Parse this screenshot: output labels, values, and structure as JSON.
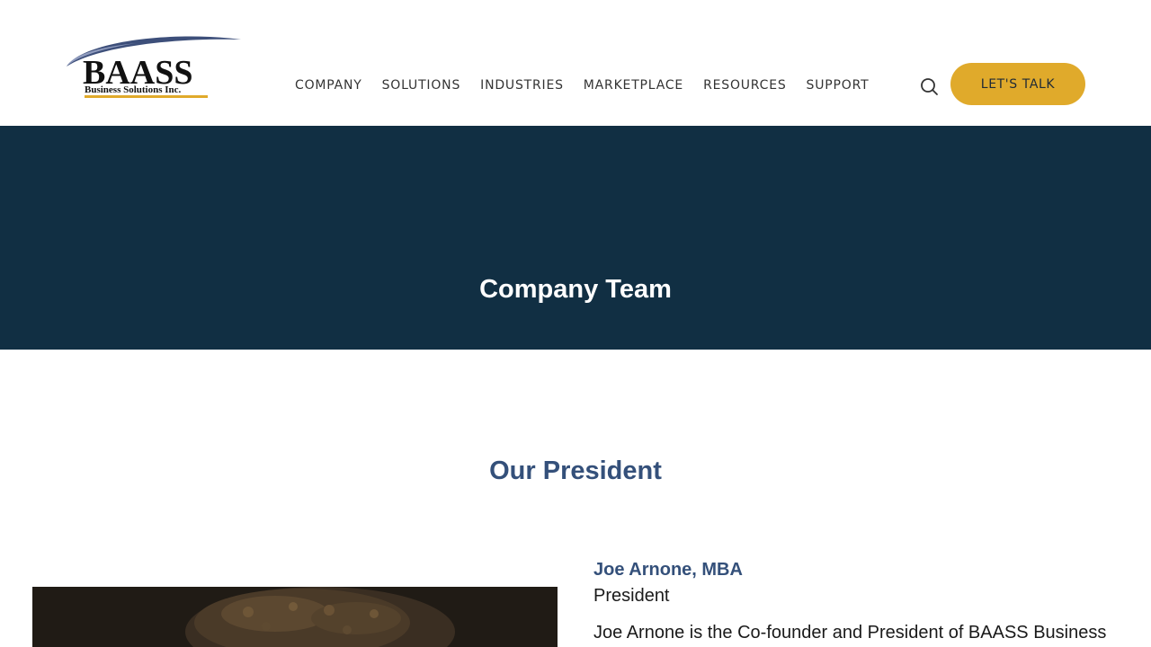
{
  "header": {
    "logo": {
      "name": "BAASS",
      "tagline": "Business Solutions Inc."
    },
    "nav": [
      {
        "label": "COMPANY"
      },
      {
        "label": "SOLUTIONS"
      },
      {
        "label": "INDUSTRIES"
      },
      {
        "label": "MARKETPLACE"
      },
      {
        "label": "RESOURCES"
      },
      {
        "label": "SUPPORT"
      }
    ],
    "search_icon": "search-icon",
    "cta_label": "LET'S TALK"
  },
  "hero": {
    "title": "Company Team"
  },
  "section": {
    "title": "Our President"
  },
  "president": {
    "name": "Joe Arnone, MBA",
    "role": "President",
    "bio_start": "Joe Arnone is the Co-founder and President of BAASS Business"
  },
  "colors": {
    "hero_bg": "#112f43",
    "accent_gold": "#e0aa2b",
    "heading_blue": "#34507a"
  }
}
